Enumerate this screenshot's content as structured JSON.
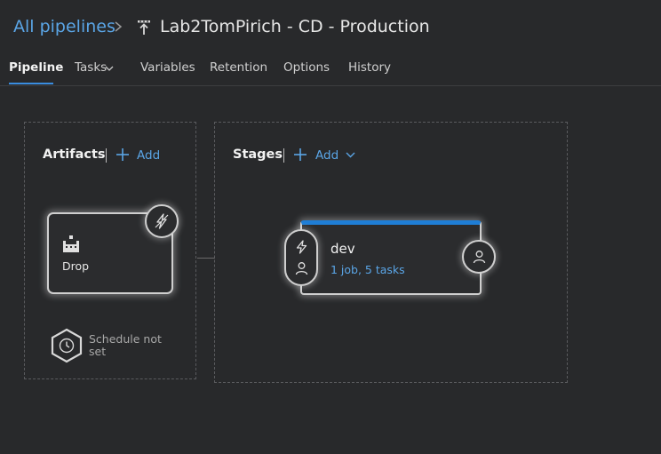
{
  "breadcrumb": {
    "root": "All pipelines",
    "title": "Lab2TomPirich - CD - Production"
  },
  "tabs": [
    {
      "label": "Pipeline",
      "active": true
    },
    {
      "label": "Tasks",
      "has_dropdown": true
    },
    {
      "label": "Variables"
    },
    {
      "label": "Retention"
    },
    {
      "label": "Options"
    },
    {
      "label": "History"
    }
  ],
  "artifacts": {
    "title": "Artifacts",
    "add_label": "Add",
    "items": [
      {
        "name": "Drop",
        "icon": "build-artifact-icon",
        "trigger_icon": "continuous-deployment-trigger-icon"
      }
    ],
    "schedule_text": "Schedule not set"
  },
  "stages": {
    "title": "Stages",
    "add_label": "Add",
    "items": [
      {
        "name": "dev",
        "summary": "1 job, 5 tasks"
      }
    ]
  },
  "colors": {
    "background": "#28292b",
    "link": "#5aa5e6",
    "accent": "#1f7ed6",
    "card_border": "#cfcfcf"
  }
}
